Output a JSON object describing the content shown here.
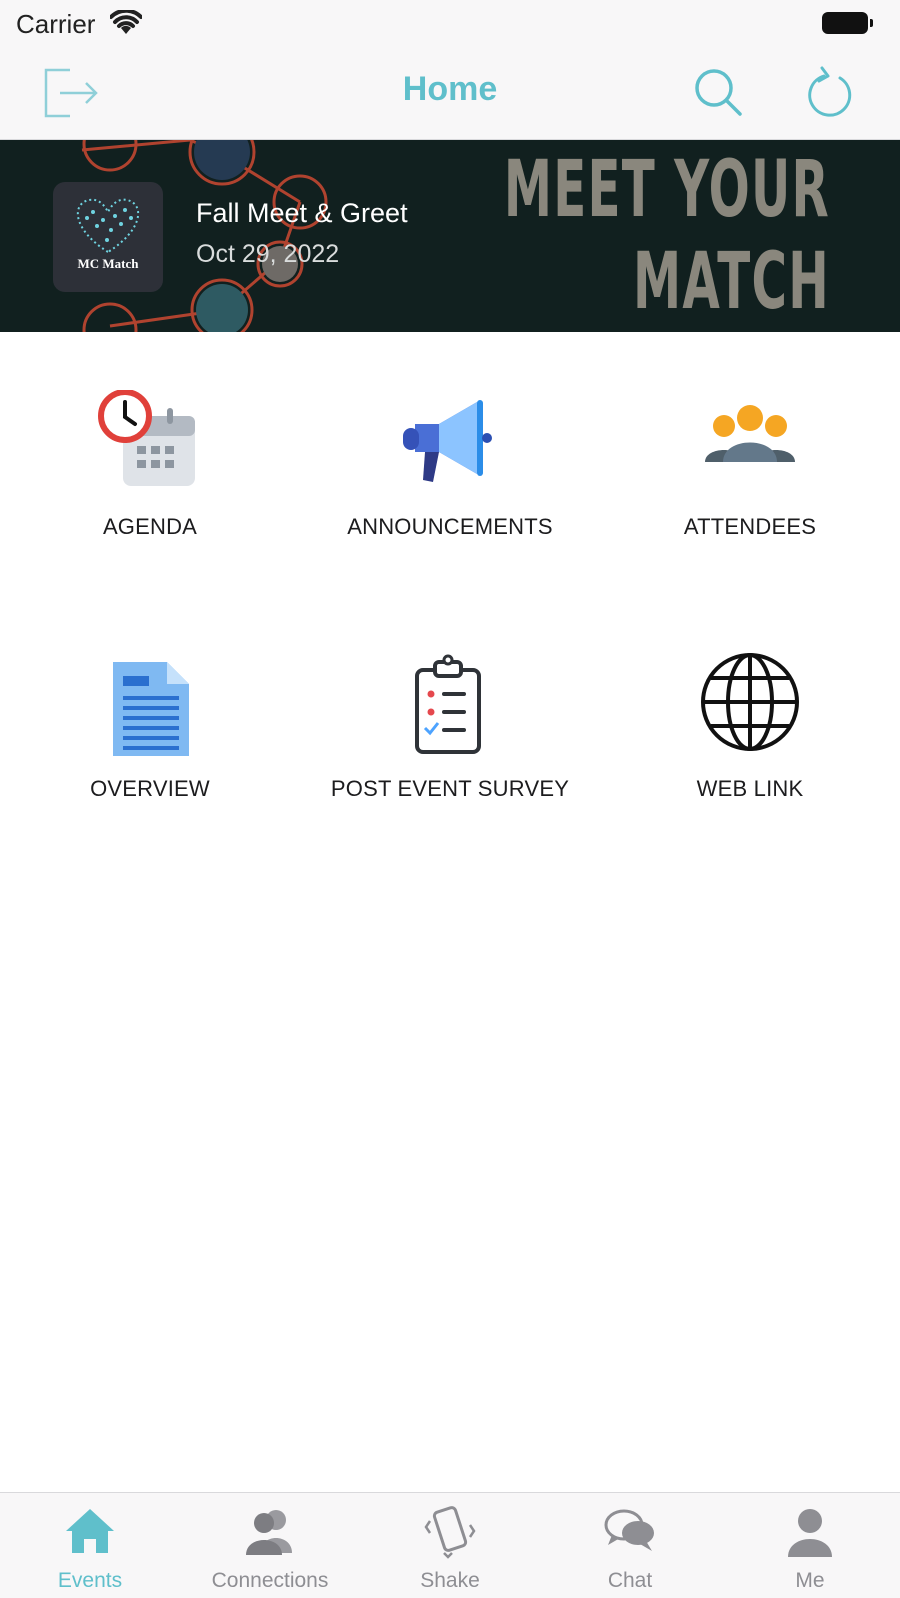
{
  "status_bar": {
    "carrier": "Carrier"
  },
  "nav": {
    "title": "Home",
    "left_icon": "logout-icon",
    "right_icons": [
      "search-icon",
      "refresh-icon"
    ],
    "accent_color": "#5fbfcb"
  },
  "banner": {
    "logo_text": "MC Match",
    "event_title": "Fall Meet & Greet",
    "event_date": "Oct 29, 2022",
    "headline_line1": "MEET YOUR",
    "headline_line2": "MATCH",
    "background_color": "#11201f"
  },
  "tiles": [
    {
      "label": "AGENDA",
      "icon": "calendar-clock-icon"
    },
    {
      "label": "ANNOUNCEMENTS",
      "icon": "megaphone-icon"
    },
    {
      "label": "ATTENDEES",
      "icon": "people-group-icon"
    },
    {
      "label": "OVERVIEW",
      "icon": "document-icon"
    },
    {
      "label": "POST EVENT SURVEY",
      "icon": "clipboard-checklist-icon"
    },
    {
      "label": "WEB LINK",
      "icon": "globe-icon"
    }
  ],
  "tab_bar": {
    "active_index": 0,
    "items": [
      {
        "label": "Events",
        "icon": "home-icon"
      },
      {
        "label": "Connections",
        "icon": "connections-icon"
      },
      {
        "label": "Shake",
        "icon": "shake-phone-icon"
      },
      {
        "label": "Chat",
        "icon": "chat-bubbles-icon"
      },
      {
        "label": "Me",
        "icon": "person-icon"
      }
    ]
  }
}
